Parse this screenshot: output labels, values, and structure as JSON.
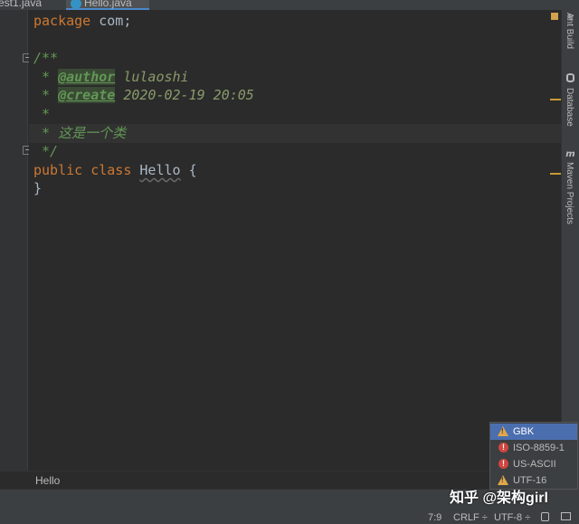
{
  "tabs": [
    {
      "label": "est1.java"
    },
    {
      "label": "Hello.java"
    }
  ],
  "code": {
    "l1_kw": "package",
    "l1_rest": " com;",
    "l3": "/**",
    "l4_prefix": " * ",
    "l4_tag": "@author",
    "l4_val": " lulaoshi",
    "l5_prefix": " * ",
    "l5_tag": "@create",
    "l5_val": " 2020-02-19 20:05",
    "l6": " *",
    "l7": " * 这是一个类",
    "l8": " */",
    "l9_kw1": "public",
    "l9_kw2": "class",
    "l9_name": "Hello",
    "l9_brace": " {",
    "l10": "}"
  },
  "right_tools": [
    {
      "label": "Ant Build",
      "icon": "ant-icon"
    },
    {
      "label": "Database",
      "icon": "database-icon"
    },
    {
      "label": "Maven Projects",
      "icon": "maven-icon",
      "icon_text": "m"
    }
  ],
  "breadcrumb": {
    "label": "Hello"
  },
  "status": {
    "position": "7:9",
    "line_sep": "CRLF",
    "line_sep_arrow": "÷",
    "encoding": "UTF-8",
    "encoding_arrow": "÷"
  },
  "encoding_popup": {
    "items": [
      {
        "label": "GBK",
        "icon": "warning-icon",
        "selected": true
      },
      {
        "label": "ISO-8859-1",
        "icon": "error-icon",
        "selected": false
      },
      {
        "label": "US-ASCII",
        "icon": "error-icon",
        "selected": false
      },
      {
        "label": "UTF-16",
        "icon": "warning-icon",
        "selected": false
      }
    ]
  },
  "watermark": "知乎 @架构girl",
  "colors": {
    "editor_bg": "#2b2b2b",
    "keyword": "#cc7832",
    "comment": "#629755",
    "selection": "#4b6eaf",
    "warning": "#e2a74a",
    "error": "#d0453f"
  }
}
